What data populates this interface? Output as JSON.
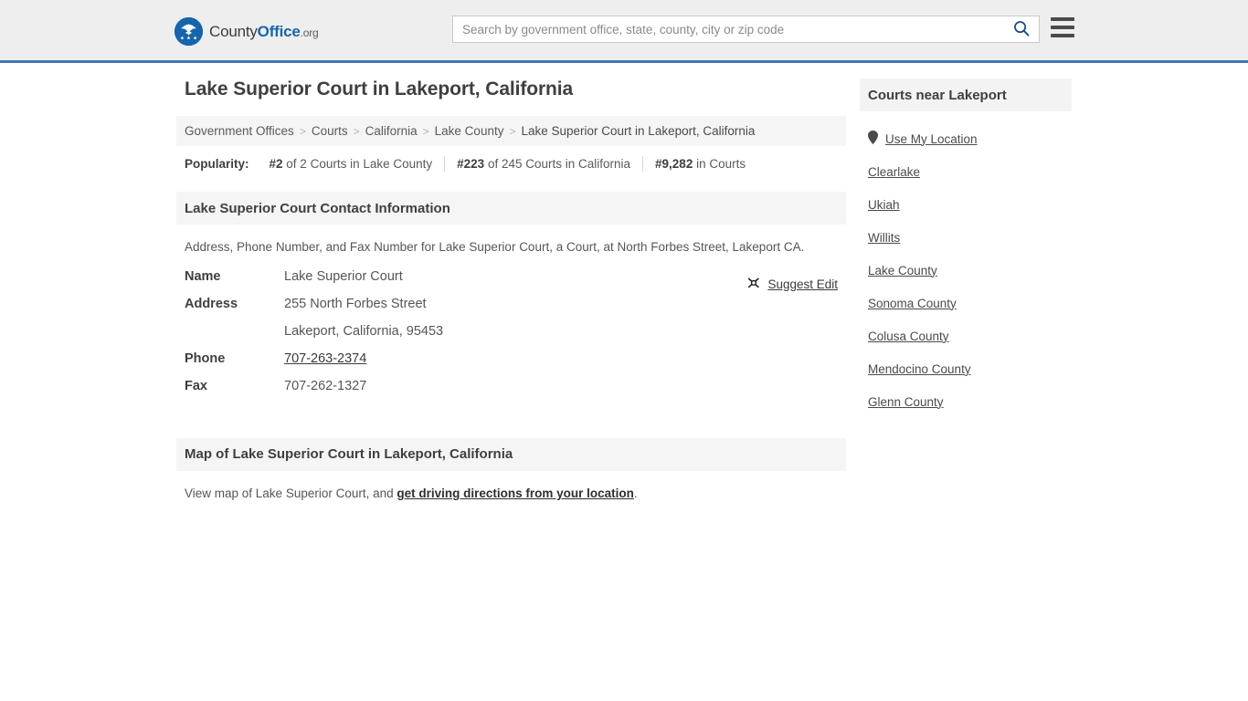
{
  "header": {
    "logo": {
      "icon": "eagle-seal-icon",
      "part1": "County",
      "part2": "Office",
      "part3": ".org",
      "brand_color": "#1565ad"
    },
    "search": {
      "placeholder": "Search by government office, state, county, city or zip code",
      "value": "",
      "search_icon": "search-icon"
    },
    "menu_icon": "hamburger-menu-icon",
    "accent_border_color": "#3d7ab0"
  },
  "main": {
    "title": "Lake Superior Court in Lakeport, California",
    "breadcrumb": {
      "separator": ">",
      "items": [
        {
          "label": "Government Offices",
          "current": false
        },
        {
          "label": "Courts",
          "current": false
        },
        {
          "label": "California",
          "current": false
        },
        {
          "label": "Lake County",
          "current": false
        },
        {
          "label": "Lake Superior Court in Lakeport, California",
          "current": true
        }
      ]
    },
    "popularity": {
      "label": "Popularity:",
      "items": [
        {
          "rank": "#2",
          "rest": " of 2 Courts in Lake County"
        },
        {
          "rank": "#223",
          "rest": " of 245 Courts in California"
        },
        {
          "rank": "#9,282",
          "rest": " in Courts"
        }
      ]
    },
    "contact_section": {
      "heading": "Lake Superior Court Contact Information",
      "description": "Address, Phone Number, and Fax Number for Lake Superior Court, a Court, at North Forbes Street, Lakeport CA.",
      "suggest_edit": {
        "label": "Suggest Edit",
        "icon": "edit-pencil-icon"
      },
      "rows": [
        {
          "key": "Name",
          "value": "Lake Superior Court",
          "link": false
        },
        {
          "key": "Address",
          "value": "255 North Forbes Street",
          "link": false
        },
        {
          "key": "",
          "value": "Lakeport, California, 95453",
          "link": false
        },
        {
          "key": "Phone",
          "value": "707-263-2374",
          "link": true
        },
        {
          "key": "Fax",
          "value": "707-262-1327",
          "link": false
        }
      ]
    },
    "map_section": {
      "heading": "Map of Lake Superior Court in Lakeport, California",
      "text_before": "View map of Lake Superior Court, and ",
      "link_label": "get driving directions from your location",
      "text_after": "."
    }
  },
  "sidebar": {
    "heading": "Courts near Lakeport",
    "items": [
      {
        "label": "Use My Location",
        "icon": "map-pin-icon"
      },
      {
        "label": "Clearlake",
        "icon": ""
      },
      {
        "label": "Ukiah",
        "icon": ""
      },
      {
        "label": "Willits",
        "icon": ""
      },
      {
        "label": "Lake County",
        "icon": ""
      },
      {
        "label": "Sonoma County",
        "icon": ""
      },
      {
        "label": "Colusa County",
        "icon": ""
      },
      {
        "label": "Mendocino County",
        "icon": ""
      },
      {
        "label": "Glenn County",
        "icon": ""
      }
    ]
  }
}
